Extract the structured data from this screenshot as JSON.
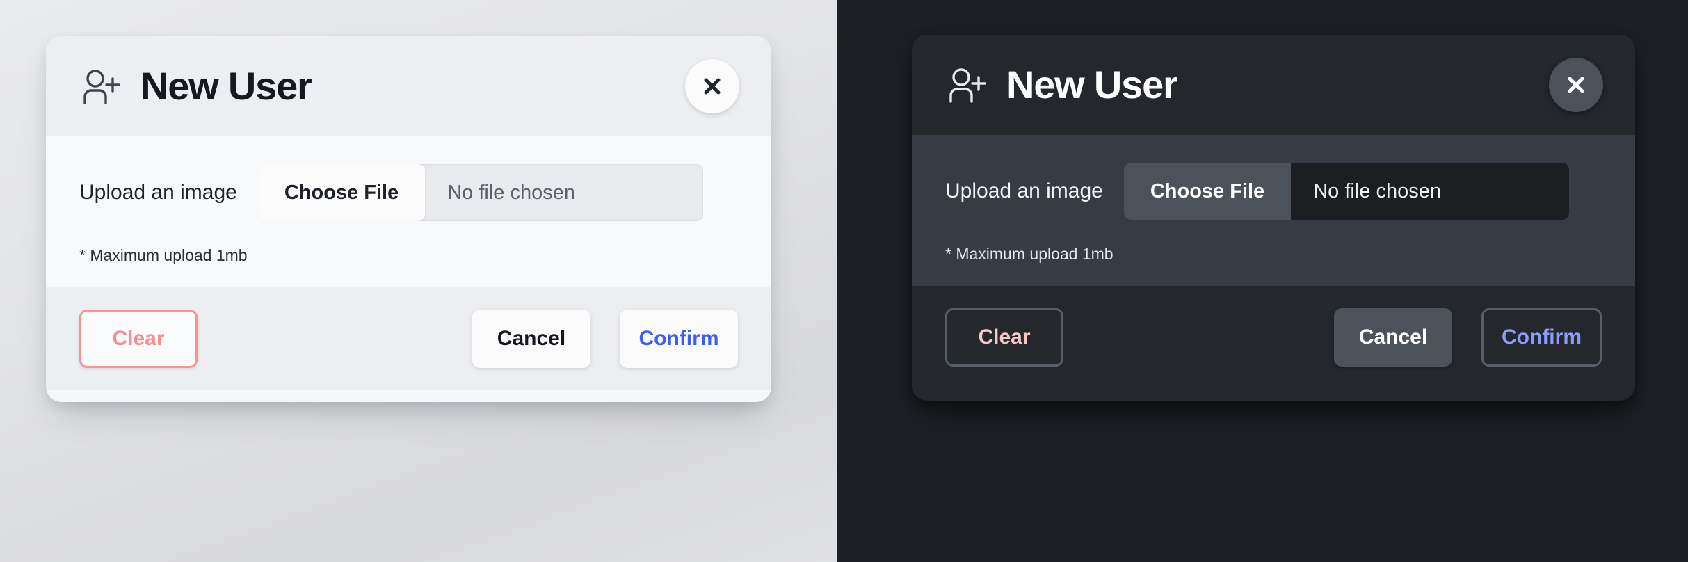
{
  "theme_colors": {
    "light_panel_background": "#e3e4e7",
    "dark_panel_background": "#1c2024",
    "light_card_body": "#f8f9fa",
    "dark_card_body": "#373c44",
    "light_card_chrome": "#eceef1",
    "dark_card_chrome": "#24282d",
    "accent_confirm_light": "#3b5bfd",
    "accent_confirm_dark": "#8b9cfb",
    "accent_clear_light": "#fa8e8e",
    "accent_clear_dark": "#f6c8c8"
  },
  "light_dialog": {
    "header": {
      "icon": "user-plus-icon",
      "title": "New User",
      "close_icon": "close-icon"
    },
    "body": {
      "upload_label": "Upload an image",
      "choose_file_label": "Choose File",
      "file_status": "No file chosen",
      "hint": "* Maximum upload 1mb"
    },
    "footer": {
      "clear_label": "Clear",
      "cancel_label": "Cancel",
      "confirm_label": "Confirm"
    }
  },
  "dark_dialog": {
    "header": {
      "icon": "user-plus-icon",
      "title": "New User",
      "close_icon": "close-icon"
    },
    "body": {
      "upload_label": "Upload an image",
      "choose_file_label": "Choose File",
      "file_status": "No file chosen",
      "hint": "* Maximum upload 1mb"
    },
    "footer": {
      "clear_label": "Clear",
      "cancel_label": "Cancel",
      "confirm_label": "Confirm"
    }
  }
}
